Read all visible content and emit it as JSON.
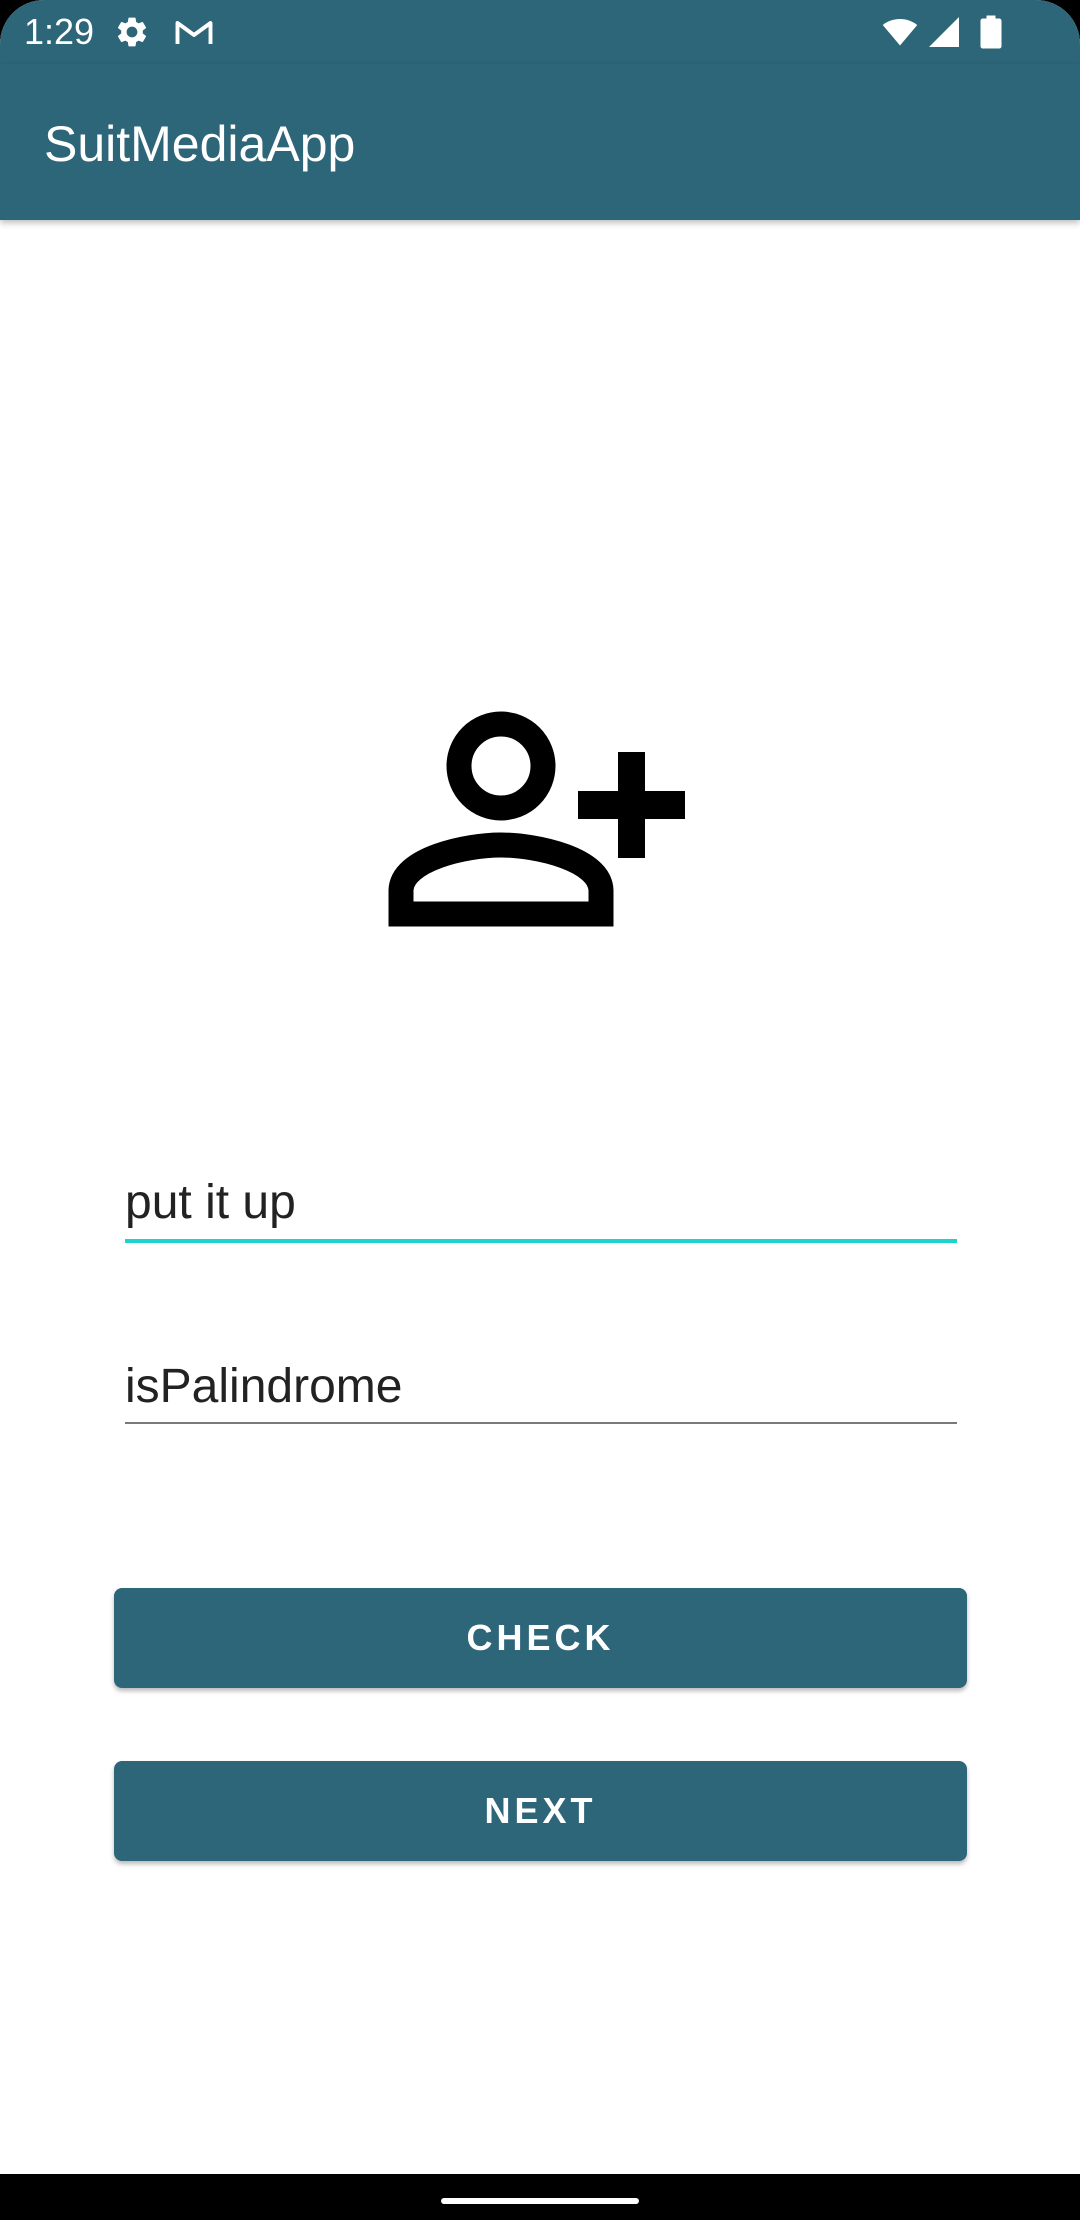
{
  "status_bar": {
    "time": "1:29",
    "icons": [
      "settings-icon",
      "gmail-icon",
      "wifi-icon",
      "signal-icon",
      "battery-icon"
    ]
  },
  "app_bar": {
    "title": "SuitMediaApp"
  },
  "main": {
    "avatar_icon": "person-add-icon",
    "name_input": {
      "value": "put it up"
    },
    "palindrome_input": {
      "value": "isPalindrome"
    },
    "check_button": {
      "label": "CHECK"
    },
    "next_button": {
      "label": "NEXT"
    }
  },
  "colors": {
    "primary": "#2d6579",
    "accent": "#1dd3cf",
    "background": "#ffffff"
  }
}
